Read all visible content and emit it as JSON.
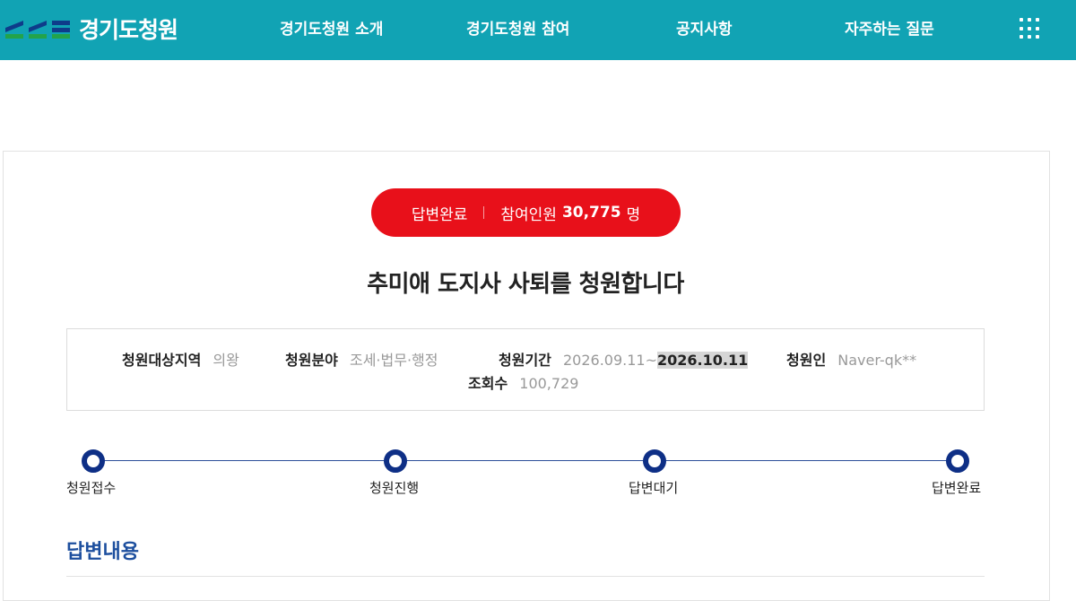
{
  "header": {
    "logo_text": "경기도청원",
    "nav": [
      {
        "label": "경기도청원 소개"
      },
      {
        "label": "경기도청원 참여"
      },
      {
        "label": "공지사항"
      },
      {
        "label": "자주하는 질문"
      }
    ],
    "menu_icon": "grid-menu-icon",
    "colors": {
      "bar": "#11a3b4"
    }
  },
  "petition": {
    "status": "답변완료",
    "participants_label": "참여인원",
    "participants_count": "30,775",
    "participants_unit": "명",
    "title": "추미애 도지사 사퇴를 청원합니다",
    "info": {
      "region_label": "청원대상지역",
      "region_value": "의왕",
      "field_label": "청원분야",
      "field_value": "조세·법무·행정",
      "period_label": "청원기간",
      "period_start": "2026.09.11~",
      "period_end": "2026.10.11",
      "petitioner_label": "청원인",
      "petitioner_value": "Naver-qk**",
      "views_label": "조회수",
      "views_value": "100,729"
    },
    "colors": {
      "status_pill": "#e8101a",
      "step": "#0e2f86",
      "heading": "#1d4f9e"
    }
  },
  "progress": {
    "steps": [
      {
        "label": "청원접수"
      },
      {
        "label": "청원진행"
      },
      {
        "label": "답변대기"
      },
      {
        "label": "답변완료"
      }
    ]
  },
  "answer": {
    "heading": "답변내용"
  }
}
